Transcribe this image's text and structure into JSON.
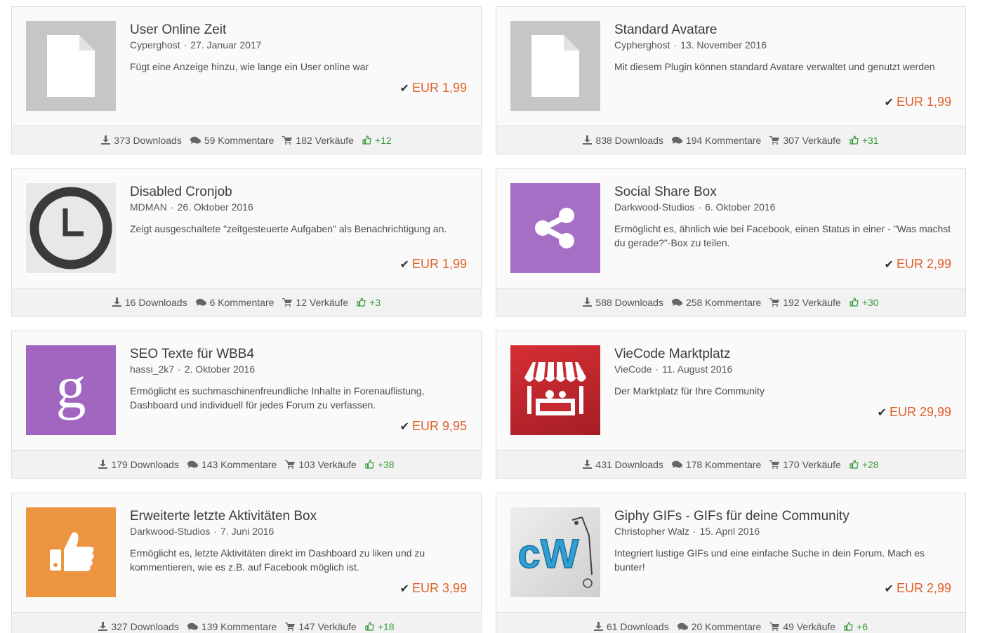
{
  "colors": {
    "price": "#e0602a",
    "likes": "#3a9a3a",
    "border": "#dcdcdc",
    "footer_bg": "#f2f2f2"
  },
  "cards": [
    {
      "title": "User Online Zeit",
      "author": "Cyperghost",
      "date": "27. Januar 2017",
      "description": "Fügt eine Anzeige hinzu, wie lange ein User online war",
      "price": "EUR 1,99",
      "downloads": "373 Downloads",
      "comments": "59 Kommentare",
      "sales": "182 Verkäufe",
      "likes": "+12",
      "icon": "document-placeholder-icon"
    },
    {
      "title": "Standard Avatare",
      "author": "Cypherghost",
      "date": "13. November 2016",
      "description": "Mit diesem Plugin können standard Avatare verwaltet und genutzt werden",
      "price": "EUR 1,99",
      "downloads": "838 Downloads",
      "comments": "194 Kommentare",
      "sales": "307 Verkäufe",
      "likes": "+31",
      "icon": "document-placeholder-icon"
    },
    {
      "title": "Disabled Cronjob",
      "author": "MDMAN",
      "date": "26. Oktober 2016",
      "description": "Zeigt ausgeschaltete \"zeitgesteuerte Aufgaben\" als Benachrichtigung an.",
      "price": "EUR 1,99",
      "downloads": "16 Downloads",
      "comments": "6 Kommentare",
      "sales": "12 Verkäufe",
      "likes": "+3",
      "icon": "clock-icon"
    },
    {
      "title": "Social Share Box",
      "author": "Darkwood-Studios",
      "date": "6. Oktober 2016",
      "description": "Ermöglicht es, ähnlich wie bei Facebook, einen Status in einer - \"Was machst du gerade?\"-Box zu teilen.",
      "price": "EUR 2,99",
      "downloads": "588 Downloads",
      "comments": "258 Kommentare",
      "sales": "192 Verkäufe",
      "likes": "+30",
      "icon": "share-icon"
    },
    {
      "title": "SEO Texte für WBB4",
      "author": "hassi_2k7",
      "date": "2. Oktober 2016",
      "description": "Ermöglicht es suchmaschinenfreundliche Inhalte in Forenauflistung, Dashboard und individuell für jedes Forum zu verfassen.",
      "price": "EUR 9,95",
      "downloads": "179 Downloads",
      "comments": "143 Kommentare",
      "sales": "103 Verkäufe",
      "likes": "+38",
      "icon": "google-g-icon",
      "icon_letter": "g"
    },
    {
      "title": "VieCode Marktplatz",
      "author": "VieCode",
      "date": "11. August 2016",
      "description": "Der Marktplatz für Ihre Community",
      "price": "EUR 29,99",
      "downloads": "431 Downloads",
      "comments": "178 Kommentare",
      "sales": "170 Verkäufe",
      "likes": "+28",
      "icon": "market-stall-icon"
    },
    {
      "title": "Erweiterte letzte Aktivitäten Box",
      "author": "Darkwood-Studios",
      "date": "7. Juni 2016",
      "description": "Ermöglicht es, letzte Aktivitäten direkt im Dashboard zu liken und zu kommentieren, wie es z.B. auf Facebook möglich ist.",
      "price": "EUR 3,99",
      "downloads": "327 Downloads",
      "comments": "139 Kommentare",
      "sales": "147 Verkäufe",
      "likes": "+18",
      "icon": "thumbs-up-icon"
    },
    {
      "title": "Giphy GIFs - GIFs für deine Community",
      "author": "Christopher Walz",
      "date": "15. April 2016",
      "description": "Integriert lustige GIFs und eine einfache Suche in dein Forum. Mach es bunter!",
      "price": "EUR 2,99",
      "downloads": "61 Downloads",
      "comments": "20 Kommentare",
      "sales": "49 Verkäufe",
      "likes": "+6",
      "icon": "cw-logo-icon",
      "icon_letters": "cW"
    }
  ]
}
